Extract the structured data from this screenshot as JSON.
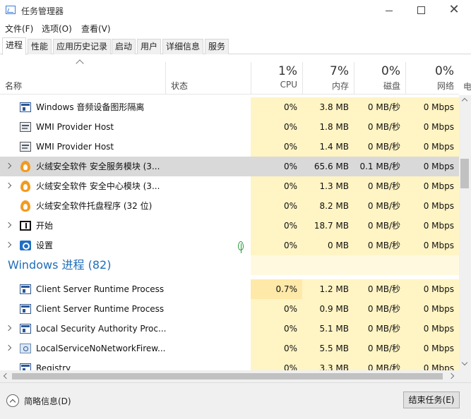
{
  "window": {
    "title": "任务管理器"
  },
  "menu": [
    "文件(F)",
    "选项(O)",
    "查看(V)"
  ],
  "tabs": [
    "进程",
    "性能",
    "应用历史记录",
    "启动",
    "用户",
    "详细信息",
    "服务"
  ],
  "active_tab": 0,
  "header": {
    "name": "名称",
    "status": "状态",
    "cpu": {
      "pct": "1%",
      "label": "CPU"
    },
    "memory": {
      "pct": "7%",
      "label": "内存"
    },
    "disk": {
      "pct": "0%",
      "label": "磁盘"
    },
    "network": {
      "pct": "0%",
      "label": "网络"
    },
    "cut_column": "电"
  },
  "rows": [
    {
      "name": "Windows 音频设备图形隔离",
      "icon": "window-icon",
      "expandable": false,
      "cpu": "0%",
      "mem": "3.8 MB",
      "disk": "0 MB/秒",
      "net": "0 Mbps"
    },
    {
      "name": "WMI Provider Host",
      "icon": "wmi-icon",
      "expandable": false,
      "cpu": "0%",
      "mem": "1.8 MB",
      "disk": "0 MB/秒",
      "net": "0 Mbps"
    },
    {
      "name": "WMI Provider Host",
      "icon": "wmi-icon",
      "expandable": false,
      "cpu": "0%",
      "mem": "1.4 MB",
      "disk": "0 MB/秒",
      "net": "0 Mbps"
    },
    {
      "name": "火绒安全软件 安全服务模块 (3...",
      "icon": "huorong-icon",
      "expandable": true,
      "selected": true,
      "cpu": "0%",
      "mem": "65.6 MB",
      "disk": "0.1 MB/秒",
      "net": "0 Mbps"
    },
    {
      "name": "火绒安全软件 安全中心模块 (3...",
      "icon": "huorong-icon",
      "expandable": true,
      "cpu": "0%",
      "mem": "1.3 MB",
      "disk": "0 MB/秒",
      "net": "0 Mbps"
    },
    {
      "name": "火绒安全软件托盘程序 (32 位)",
      "icon": "huorong-icon",
      "expandable": false,
      "cpu": "0%",
      "mem": "8.2 MB",
      "disk": "0 MB/秒",
      "net": "0 Mbps"
    },
    {
      "name": "开始",
      "icon": "start-icon",
      "expandable": true,
      "cpu": "0%",
      "mem": "18.7 MB",
      "disk": "0 MB/秒",
      "net": "0 Mbps"
    },
    {
      "name": "设置",
      "icon": "settings-gear-icon",
      "expandable": true,
      "suspended_leaf": true,
      "cpu": "0%",
      "mem": "0 MB",
      "disk": "0 MB/秒",
      "net": "0 Mbps"
    }
  ],
  "group": {
    "title": "Windows 进程 (82)"
  },
  "win_rows": [
    {
      "name": "Client Server Runtime Process",
      "icon": "window-icon",
      "expandable": false,
      "cpu": "0.7%",
      "mem": "1.2 MB",
      "disk": "0 MB/秒",
      "net": "0 Mbps"
    },
    {
      "name": "Client Server Runtime Process",
      "icon": "window-icon",
      "expandable": false,
      "cpu": "0%",
      "mem": "0.9 MB",
      "disk": "0 MB/秒",
      "net": "0 Mbps"
    },
    {
      "name": "Local Security Authority Proc...",
      "icon": "window-icon",
      "expandable": true,
      "cpu": "0%",
      "mem": "5.1 MB",
      "disk": "0 MB/秒",
      "net": "0 Mbps"
    },
    {
      "name": "LocalServiceNoNetworkFirew...",
      "icon": "service-icon",
      "expandable": true,
      "cpu": "0%",
      "mem": "5.5 MB",
      "disk": "0 MB/秒",
      "net": "0 Mbps"
    },
    {
      "name": "Registry",
      "icon": "window-icon",
      "expandable": false,
      "cpu": "0%",
      "mem": "3.3 MB",
      "disk": "0 MB/秒",
      "net": "0 Mbps"
    }
  ],
  "footer": {
    "fewer_details": "简略信息(D)",
    "end_task": "结束任务(E)"
  },
  "colors": {
    "cpu_heat_low": "#fff4c4",
    "cpu_heat_high": "#ffe9a8",
    "group_title": "#1e6db8",
    "selection": "#d9d9d9"
  }
}
